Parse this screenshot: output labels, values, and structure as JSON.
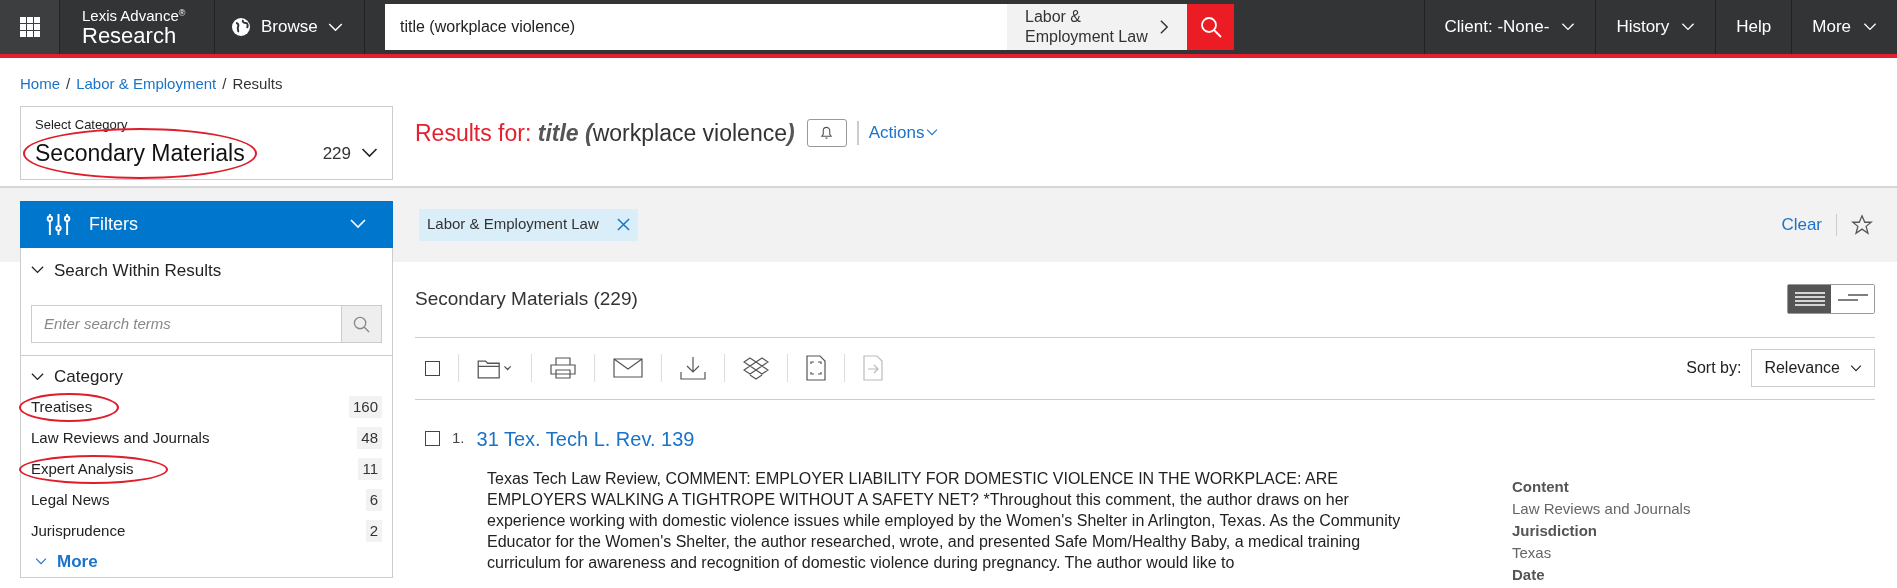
{
  "top_bar": {
    "brand_top": "Lexis Advance",
    "brand_mark": "®",
    "brand_bottom": "Research",
    "browse": "Browse",
    "search_value": "title (workplace violence)",
    "scope": "Labor & Employment Law",
    "nav": [
      {
        "label": "Client: -None-",
        "dropdown": true
      },
      {
        "label": "History",
        "dropdown": true
      },
      {
        "label": "Help",
        "dropdown": false
      },
      {
        "label": "More",
        "dropdown": true
      }
    ]
  },
  "breadcrumb": [
    {
      "label": "Home",
      "link": true
    },
    {
      "separator": "/",
      "label": "Labor & Employment",
      "link": true
    },
    {
      "separator": "/",
      "label": "Results",
      "link": false
    }
  ],
  "category_select": {
    "label": "Select Category",
    "value": "Secondary Materials",
    "count": "229",
    "circled": true
  },
  "results_header": {
    "prefix": "Results for:",
    "field": "title",
    "open": "(",
    "query": "workplace violence",
    "close": ")",
    "actions": "Actions"
  },
  "filter_tag": "Labor & Employment Law",
  "clear": "Clear",
  "filters": {
    "title": "Filters",
    "search_section": "Search Within Results",
    "search_placeholder": "Enter search terms",
    "category_section": "Category",
    "categories": [
      {
        "label": "Treatises",
        "count": "160",
        "circled": true
      },
      {
        "label": "Law Reviews and Journals",
        "count": "48",
        "circled": false
      },
      {
        "label": "Expert Analysis",
        "count": "11",
        "circled": true
      },
      {
        "label": "Legal News",
        "count": "6",
        "circled": false
      },
      {
        "label": "Jurisprudence",
        "count": "2",
        "circled": false
      }
    ],
    "more": "More"
  },
  "list_title": "Secondary Materials (229)",
  "view_options": [
    {
      "kind": "full",
      "selected": true
    },
    {
      "kind": "compact",
      "selected": false
    }
  ],
  "select_all_checked": false,
  "sort": {
    "label": "Sort by:",
    "value": "Relevance"
  },
  "results": [
    {
      "number": "1.",
      "title": "31 Tex. Tech L. Rev. 139",
      "checked": false,
      "snippet": "Texas Tech Law Review, COMMENT: EMPLOYER LIABILITY FOR DOMESTIC VIOLENCE IN THE WORKPLACE: ARE EMPLOYERS WALKING A TIGHTROPE WITHOUT A SAFETY NET? *Throughout this comment, the author draws on her experience working with domestic violence issues while employed by the Women's Shelter in Arlington, Texas. As the Community Educator for the Women's Shelter, the author researched, wrote, and presented Safe Mom/Healthy Baby, a medical training curriculum for awareness and recognition of domestic violence during pregnancy. The author would like to",
      "meta": [
        {
          "label": "Content",
          "value": "Law Reviews and Journals"
        },
        {
          "label": "Jurisdiction",
          "value": "Texas"
        },
        {
          "label": "Date"
        }
      ]
    }
  ]
}
